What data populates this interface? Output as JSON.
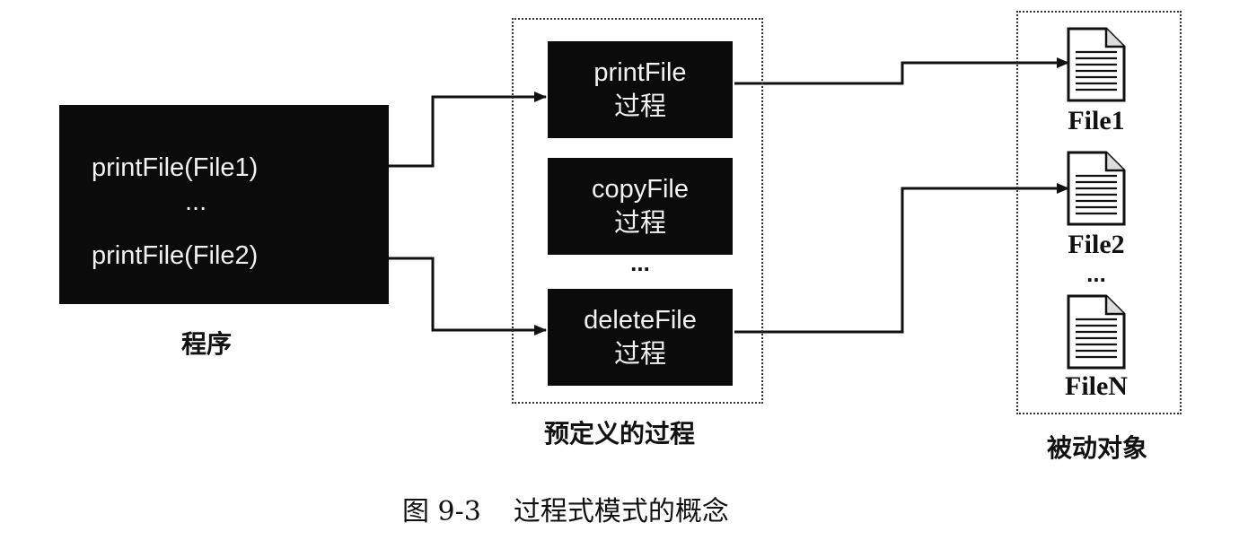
{
  "program": {
    "lines": [
      "printFile(File1)",
      "...",
      "printFile(File2)"
    ],
    "label": "程序"
  },
  "procedures": {
    "items": [
      {
        "name": "printFile",
        "suffix": "过程"
      },
      {
        "name": "copyFile",
        "suffix": "过程"
      },
      {
        "name": "deleteFile",
        "suffix": "过程"
      }
    ],
    "ellipsis": "...",
    "label": "预定义的过程"
  },
  "passive_objects": {
    "files": [
      "File1",
      "File2",
      "FileN"
    ],
    "ellipsis": "...",
    "label": "被动对象",
    "icon": "document-icon"
  },
  "caption": {
    "number": "图 9-3",
    "text": "过程式模式的概念"
  }
}
